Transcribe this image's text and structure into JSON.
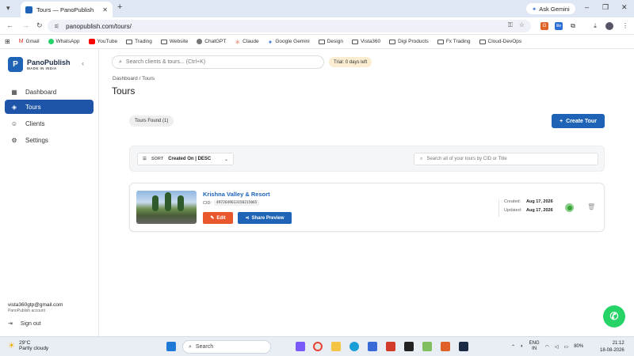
{
  "browser": {
    "tab_title": "Tours — PanoPublish",
    "url": "panopublish.com/tours/",
    "ask_gemini": "Ask Gemini",
    "bookmarks": [
      "Gmail",
      "WhatsApp",
      "YouTube",
      "Trading",
      "Website",
      "ChatGPT",
      "Claude",
      "Google Gemini",
      "Design",
      "Vista360",
      "Digi Products",
      "Fx Trading",
      "Cloud-DevOps"
    ]
  },
  "app": {
    "logo_letter": "P",
    "brand": "PanoPublish",
    "brand_sub": "MADE IN INDIA",
    "nav": [
      {
        "label": "Dashboard",
        "icon": "grid-icon",
        "icon_glyph": "▦"
      },
      {
        "label": "Tours",
        "icon": "layers-icon",
        "icon_glyph": "◈"
      },
      {
        "label": "Clients",
        "icon": "users-icon",
        "icon_glyph": "☺"
      },
      {
        "label": "Settings",
        "icon": "gear-icon",
        "icon_glyph": "⚙"
      }
    ],
    "user_email": "vista360gtp@gmail.com",
    "user_account": "PanoPublish account",
    "sign_out": "Sign out"
  },
  "header": {
    "search_placeholder": "Search clients & tours... (Ctrl+K)",
    "trial_badge": "Trial: 0 days left"
  },
  "page": {
    "breadcrumb": "Dashboard  /  Tours",
    "title": "Tours",
    "found_badge": "Tours Found (1)",
    "create_button": "Create Tour",
    "sort_label": "SORT",
    "sort_value": "Created On | DESC",
    "tour_search_placeholder": "Search all of your tours by CID or Title"
  },
  "tours": [
    {
      "title": "Krishna Valley & Resort",
      "cid_label": "CID:",
      "cid": "4972649613150215065",
      "edit_label": "Edit",
      "share_label": "Share Preview",
      "created_label": "Created:",
      "created": "Aug 17, 2026",
      "updated_label": "Updated:",
      "updated": "Aug 17, 2026",
      "status_color": "#3aa33a"
    }
  ],
  "taskbar": {
    "temp": "29°C",
    "weather": "Partly cloudy",
    "search": "Search",
    "lang1": "ENG",
    "lang2": "IN",
    "battery": "80%",
    "time": "21:12",
    "date": "18-08-2026"
  },
  "colors": {
    "accent": "#1e63b5",
    "edit": "#e8582a",
    "whatsapp": "#25d366"
  }
}
